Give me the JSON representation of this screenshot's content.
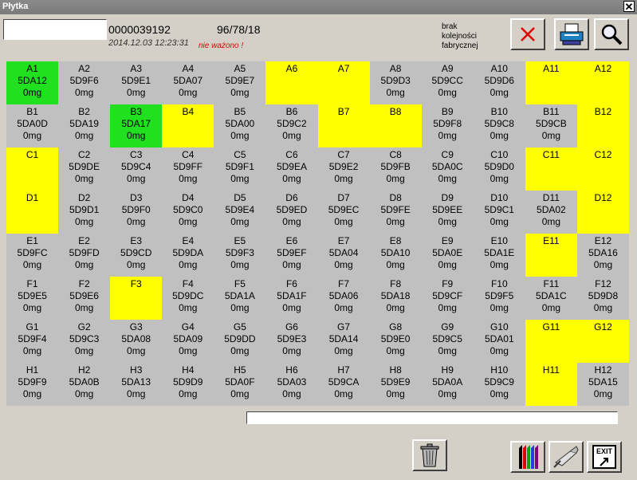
{
  "window": {
    "title": "Płytka",
    "close_glyph": "✕"
  },
  "header": {
    "search_value": "",
    "plate_id": "0000039192",
    "ratio": "96/78/18",
    "timestamp": "2014.12.03 12:23:31",
    "status": "nie ważono !",
    "order_msg": [
      "brak",
      "kolejności",
      "fabrycznej"
    ]
  },
  "colors": {
    "yellow": "#ffff00",
    "green": "#20e020",
    "gray": "#c0c0c0"
  },
  "wells": [
    [
      {
        "n": "A1",
        "c": "5DA12",
        "m": "0mg",
        "s": "green"
      },
      {
        "n": "A2",
        "c": "5D9F6",
        "m": "0mg",
        "s": ""
      },
      {
        "n": "A3",
        "c": "5D9E1",
        "m": "0mg",
        "s": ""
      },
      {
        "n": "A4",
        "c": "5DA07",
        "m": "0mg",
        "s": ""
      },
      {
        "n": "A5",
        "c": "5D9E7",
        "m": "0mg",
        "s": ""
      },
      {
        "n": "A6",
        "c": "",
        "m": "",
        "s": "yellow"
      },
      {
        "n": "A7",
        "c": "",
        "m": "",
        "s": "yellow"
      },
      {
        "n": "A8",
        "c": "5D9D3",
        "m": "0mg",
        "s": ""
      },
      {
        "n": "A9",
        "c": "5D9CC",
        "m": "0mg",
        "s": ""
      },
      {
        "n": "A10",
        "c": "5D9D6",
        "m": "0mg",
        "s": ""
      },
      {
        "n": "A11",
        "c": "",
        "m": "",
        "s": "yellow"
      },
      {
        "n": "A12",
        "c": "",
        "m": "",
        "s": "yellow"
      }
    ],
    [
      {
        "n": "B1",
        "c": "5DA0D",
        "m": "0mg",
        "s": ""
      },
      {
        "n": "B2",
        "c": "5DA19",
        "m": "0mg",
        "s": ""
      },
      {
        "n": "B3",
        "c": "5DA17",
        "m": "0mg",
        "s": "green"
      },
      {
        "n": "B4",
        "c": "",
        "m": "",
        "s": "yellow"
      },
      {
        "n": "B5",
        "c": "5DA00",
        "m": "0mg",
        "s": ""
      },
      {
        "n": "B6",
        "c": "5D9C2",
        "m": "0mg",
        "s": ""
      },
      {
        "n": "B7",
        "c": "",
        "m": "",
        "s": "yellow"
      },
      {
        "n": "B8",
        "c": "",
        "m": "",
        "s": "yellow"
      },
      {
        "n": "B9",
        "c": "5D9F8",
        "m": "0mg",
        "s": ""
      },
      {
        "n": "B10",
        "c": "5D9C8",
        "m": "0mg",
        "s": ""
      },
      {
        "n": "B11",
        "c": "5D9CB",
        "m": "0mg",
        "s": ""
      },
      {
        "n": "B12",
        "c": "",
        "m": "",
        "s": "yellow"
      }
    ],
    [
      {
        "n": "C1",
        "c": "",
        "m": "",
        "s": "yellow"
      },
      {
        "n": "C2",
        "c": "5D9DE",
        "m": "0mg",
        "s": ""
      },
      {
        "n": "C3",
        "c": "5D9C4",
        "m": "0mg",
        "s": ""
      },
      {
        "n": "C4",
        "c": "5D9FF",
        "m": "0mg",
        "s": ""
      },
      {
        "n": "C5",
        "c": "5D9F1",
        "m": "0mg",
        "s": ""
      },
      {
        "n": "C6",
        "c": "5D9EA",
        "m": "0mg",
        "s": ""
      },
      {
        "n": "C7",
        "c": "5D9E2",
        "m": "0mg",
        "s": ""
      },
      {
        "n": "C8",
        "c": "5D9FB",
        "m": "0mg",
        "s": ""
      },
      {
        "n": "C9",
        "c": "5DA0C",
        "m": "0mg",
        "s": ""
      },
      {
        "n": "C10",
        "c": "5D9D0",
        "m": "0mg",
        "s": ""
      },
      {
        "n": "C11",
        "c": "",
        "m": "",
        "s": "yellow"
      },
      {
        "n": "C12",
        "c": "",
        "m": "",
        "s": "yellow"
      }
    ],
    [
      {
        "n": "D1",
        "c": "",
        "m": "",
        "s": "yellow"
      },
      {
        "n": "D2",
        "c": "5D9D1",
        "m": "0mg",
        "s": ""
      },
      {
        "n": "D3",
        "c": "5D9F0",
        "m": "0mg",
        "s": ""
      },
      {
        "n": "D4",
        "c": "5D9C0",
        "m": "0mg",
        "s": ""
      },
      {
        "n": "D5",
        "c": "5D9E4",
        "m": "0mg",
        "s": ""
      },
      {
        "n": "D6",
        "c": "5D9ED",
        "m": "0mg",
        "s": ""
      },
      {
        "n": "D7",
        "c": "5D9EC",
        "m": "0mg",
        "s": ""
      },
      {
        "n": "D8",
        "c": "5D9FE",
        "m": "0mg",
        "s": ""
      },
      {
        "n": "D9",
        "c": "5D9EE",
        "m": "0mg",
        "s": ""
      },
      {
        "n": "D10",
        "c": "5D9C1",
        "m": "0mg",
        "s": ""
      },
      {
        "n": "D11",
        "c": "5DA02",
        "m": "0mg",
        "s": ""
      },
      {
        "n": "D12",
        "c": "",
        "m": "",
        "s": "yellow"
      }
    ],
    [
      {
        "n": "E1",
        "c": "5D9FC",
        "m": "0mg",
        "s": ""
      },
      {
        "n": "E2",
        "c": "5D9FD",
        "m": "0mg",
        "s": ""
      },
      {
        "n": "E3",
        "c": "5D9CD",
        "m": "0mg",
        "s": ""
      },
      {
        "n": "E4",
        "c": "5D9DA",
        "m": "0mg",
        "s": ""
      },
      {
        "n": "E5",
        "c": "5D9F3",
        "m": "0mg",
        "s": ""
      },
      {
        "n": "E6",
        "c": "5D9EF",
        "m": "0mg",
        "s": ""
      },
      {
        "n": "E7",
        "c": "5DA04",
        "m": "0mg",
        "s": ""
      },
      {
        "n": "E8",
        "c": "5DA10",
        "m": "0mg",
        "s": ""
      },
      {
        "n": "E9",
        "c": "5DA0E",
        "m": "0mg",
        "s": ""
      },
      {
        "n": "E10",
        "c": "5DA1E",
        "m": "0mg",
        "s": ""
      },
      {
        "n": "E11",
        "c": "",
        "m": "",
        "s": "yellow"
      },
      {
        "n": "E12",
        "c": "5DA16",
        "m": "0mg",
        "s": ""
      }
    ],
    [
      {
        "n": "F1",
        "c": "5D9E5",
        "m": "0mg",
        "s": ""
      },
      {
        "n": "F2",
        "c": "5D9E6",
        "m": "0mg",
        "s": ""
      },
      {
        "n": "F3",
        "c": "",
        "m": "",
        "s": "yellow"
      },
      {
        "n": "F4",
        "c": "5D9DC",
        "m": "0mg",
        "s": ""
      },
      {
        "n": "F5",
        "c": "5DA1A",
        "m": "0mg",
        "s": ""
      },
      {
        "n": "F6",
        "c": "5DA1F",
        "m": "0mg",
        "s": ""
      },
      {
        "n": "F7",
        "c": "5DA06",
        "m": "0mg",
        "s": ""
      },
      {
        "n": "F8",
        "c": "5DA18",
        "m": "0mg",
        "s": ""
      },
      {
        "n": "F9",
        "c": "5D9CF",
        "m": "0mg",
        "s": ""
      },
      {
        "n": "F10",
        "c": "5D9F5",
        "m": "0mg",
        "s": ""
      },
      {
        "n": "F11",
        "c": "5DA1C",
        "m": "0mg",
        "s": ""
      },
      {
        "n": "F12",
        "c": "5D9D8",
        "m": "0mg",
        "s": ""
      }
    ],
    [
      {
        "n": "G1",
        "c": "5D9F4",
        "m": "0mg",
        "s": ""
      },
      {
        "n": "G2",
        "c": "5D9C3",
        "m": "0mg",
        "s": ""
      },
      {
        "n": "G3",
        "c": "5DA08",
        "m": "0mg",
        "s": ""
      },
      {
        "n": "G4",
        "c": "5DA09",
        "m": "0mg",
        "s": ""
      },
      {
        "n": "G5",
        "c": "5D9DD",
        "m": "0mg",
        "s": ""
      },
      {
        "n": "G6",
        "c": "5D9E3",
        "m": "0mg",
        "s": ""
      },
      {
        "n": "G7",
        "c": "5DA14",
        "m": "0mg",
        "s": ""
      },
      {
        "n": "G8",
        "c": "5D9E0",
        "m": "0mg",
        "s": ""
      },
      {
        "n": "G9",
        "c": "5D9C5",
        "m": "0mg",
        "s": ""
      },
      {
        "n": "G10",
        "c": "5DA01",
        "m": "0mg",
        "s": ""
      },
      {
        "n": "G11",
        "c": "",
        "m": "",
        "s": "yellow"
      },
      {
        "n": "G12",
        "c": "",
        "m": "",
        "s": "yellow"
      }
    ],
    [
      {
        "n": "H1",
        "c": "5D9F9",
        "m": "0mg",
        "s": ""
      },
      {
        "n": "H2",
        "c": "5DA0B",
        "m": "0mg",
        "s": ""
      },
      {
        "n": "H3",
        "c": "5DA13",
        "m": "0mg",
        "s": ""
      },
      {
        "n": "H4",
        "c": "5D9D9",
        "m": "0mg",
        "s": ""
      },
      {
        "n": "H5",
        "c": "5DA0F",
        "m": "0mg",
        "s": ""
      },
      {
        "n": "H6",
        "c": "5DA03",
        "m": "0mg",
        "s": ""
      },
      {
        "n": "H7",
        "c": "5D9CA",
        "m": "0mg",
        "s": ""
      },
      {
        "n": "H8",
        "c": "5D9E9",
        "m": "0mg",
        "s": ""
      },
      {
        "n": "H9",
        "c": "5DA0A",
        "m": "0mg",
        "s": ""
      },
      {
        "n": "H10",
        "c": "5D9C9",
        "m": "0mg",
        "s": ""
      },
      {
        "n": "H11",
        "c": "",
        "m": "",
        "s": "yellow"
      },
      {
        "n": "H12",
        "c": "5DA15",
        "m": "0mg",
        "s": ""
      }
    ]
  ],
  "toolbar": {
    "cancel_icon": "x-icon",
    "print_icon": "printer-icon",
    "search_icon": "magnifier-icon",
    "delete_icon": "trash-icon",
    "colors_icon": "crayons-icon",
    "scanner_icon": "barcode-scanner-icon",
    "exit_label": "EXIT"
  },
  "status_bar": {
    "value": ""
  }
}
